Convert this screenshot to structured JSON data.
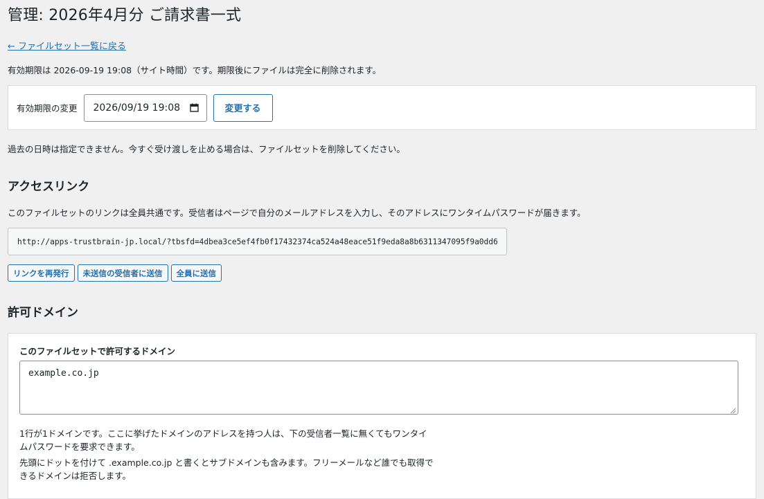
{
  "header": {
    "title": "管理: 2026年4月分 ご請求書一式",
    "back_link": "← ファイルセット一覧に戻る"
  },
  "expiry": {
    "info_text": "有効期限は 2026-09-19 19:08（サイト時間）です。期限後にファイルは完全に削除されます。",
    "change_label": "有効期限の変更",
    "date_value": "2026/09/19 19:08",
    "change_button": "変更する",
    "note": "過去の日時は指定できません。今すぐ受け渡しを止める場合は、ファイルセットを削除してください。"
  },
  "access": {
    "title": "アクセスリンク",
    "description": "このファイルセットのリンクは全員共通です。受信者はページで自分のメールアドレスを入力し、そのアドレスにワンタイムパスワードが届きます。",
    "url": "http://apps-trustbrain-jp.local/?tbsfd=4dbea3ce5ef4fb0f17432374ca524a48eace51f9eda8a8b6311347095f9a0dd6",
    "buttons": {
      "reissue": "リンクを再発行",
      "send_unsent": "未送信の受信者に送信",
      "send_all": "全員に送信"
    }
  },
  "domains": {
    "title": "許可ドメイン",
    "field_label": "このファイルセットで許可するドメイン",
    "value": "example.co.jp",
    "help1": "1行が1ドメインです。ここに挙げたドメインのアドレスを持つ人は、下の受信者一覧に無くてもワンタイムパスワードを要求できます。",
    "help2": "先頭にドットを付けて .example.co.jp と書くとサブドメインも含みます。フリーメールなど誰でも取得できるドメインは拒否します。"
  },
  "colors": {
    "accent": "#2271b1",
    "background": "#f0f0f1",
    "text": "#1d2327"
  },
  "icons": {
    "calendar": "calendar-icon",
    "resize": "resize-handle-icon"
  }
}
